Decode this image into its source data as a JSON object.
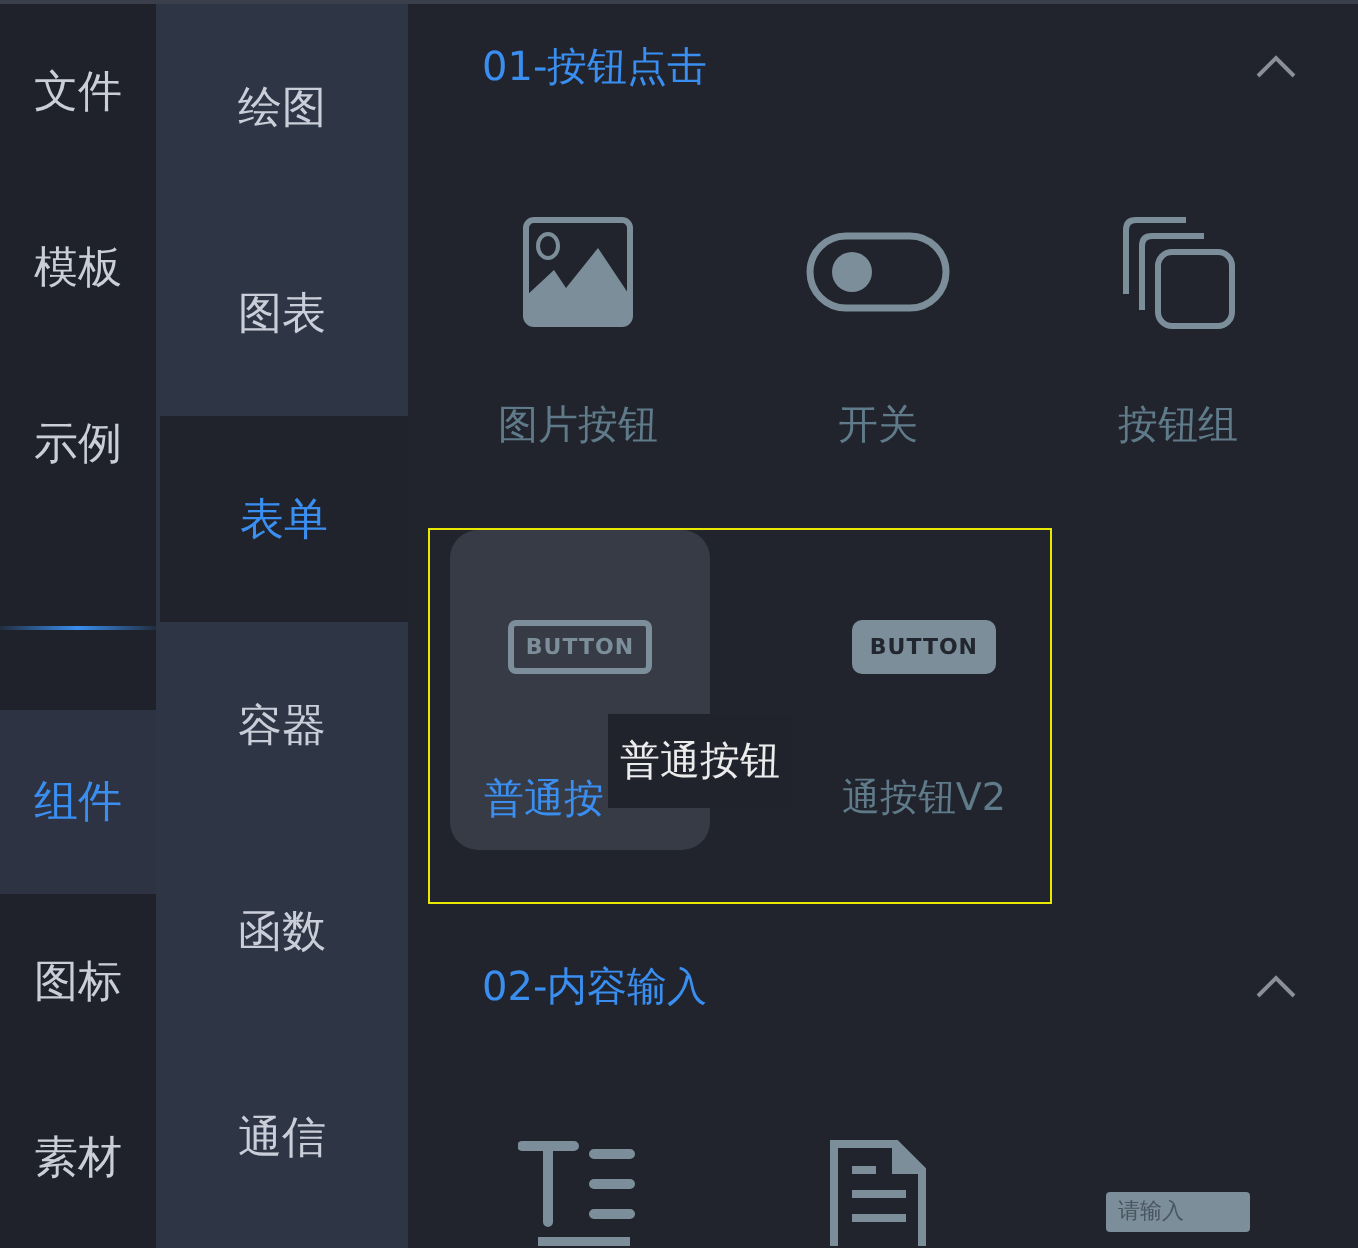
{
  "primary_nav": [
    {
      "label": "文件",
      "selected": false
    },
    {
      "label": "模板",
      "selected": false
    },
    {
      "label": "示例",
      "selected": false
    },
    {
      "kind": "divider"
    },
    {
      "label": "组件",
      "selected": true
    },
    {
      "label": "图标",
      "selected": false
    },
    {
      "label": "素材",
      "selected": false
    }
  ],
  "secondary_nav": [
    {
      "label": "绘图",
      "selected": false
    },
    {
      "label": "图表",
      "selected": false
    },
    {
      "label": "表单",
      "selected": true
    },
    {
      "label": "容器",
      "selected": false
    },
    {
      "label": "函数",
      "selected": false
    },
    {
      "label": "通信",
      "selected": false
    }
  ],
  "sections": [
    {
      "title": "01-按钮点击",
      "expanded": true,
      "rows": [
        {
          "items": [
            {
              "kind": "image",
              "label": "图片按钮",
              "selected": false
            },
            {
              "kind": "toggle",
              "label": "开关",
              "selected": false
            },
            {
              "kind": "stack",
              "label": "按钮组",
              "selected": false
            }
          ]
        },
        {
          "outlined": true,
          "items": [
            {
              "kind": "button_outline",
              "preview_text": "BUTTON",
              "label": "普通按",
              "selected": true,
              "tooltip": "普通按钮"
            },
            {
              "kind": "button_filled",
              "preview_text": "BUTTON",
              "label": "通按钮V2",
              "selected": false
            }
          ]
        }
      ]
    },
    {
      "title": "02-内容输入",
      "expanded": true,
      "rows": [
        {
          "items": [
            {
              "kind": "text_lines",
              "selected": false
            },
            {
              "kind": "document",
              "selected": false
            },
            {
              "kind": "input",
              "preview_text": "请输入",
              "selected": false
            }
          ]
        }
      ]
    }
  ]
}
